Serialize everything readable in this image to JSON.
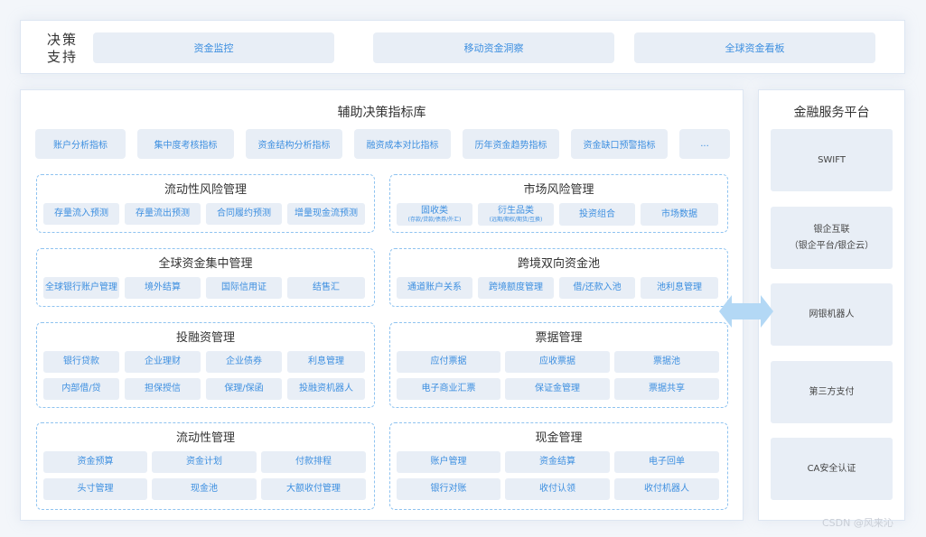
{
  "decision_support": {
    "label_line1": "决策",
    "label_line2": "支持",
    "buttons": [
      "资金监控",
      "移动资金洞察",
      "全球资金看板"
    ]
  },
  "indicator_library": {
    "title": "辅助决策指标库",
    "indicators": [
      "账户分析指标",
      "集中度考核指标",
      "资金结构分析指标",
      "融资成本对比指标",
      "历年资金趋势指标",
      "资金缺口预警指标",
      "..."
    ]
  },
  "groups": {
    "liquidity_risk": {
      "title": "流动性风险管理",
      "items": [
        "存量流入预测",
        "存量流出预测",
        "合同履约预测",
        "增量现金流预测"
      ]
    },
    "market_risk": {
      "title": "市场风险管理",
      "items": [
        {
          "label": "固收类",
          "sub": "(存款/贷款/债券/外汇)"
        },
        {
          "label": "衍生品类",
          "sub": "(远期/期权/期货/互换)"
        },
        {
          "label": "投资组合",
          "sub": ""
        },
        {
          "label": "市场数据",
          "sub": ""
        }
      ]
    },
    "global_concentration": {
      "title": "全球资金集中管理",
      "items": [
        "全球银行账户管理",
        "境外结算",
        "国际信用证",
        "结售汇"
      ]
    },
    "cross_border_pool": {
      "title": "跨境双向资金池",
      "items": [
        "通道账户关系",
        "跨境额度管理",
        "借/还款入池",
        "池利息管理"
      ]
    },
    "investment_financing": {
      "title": "投融资管理",
      "items": [
        "银行贷款",
        "企业理财",
        "企业债券",
        "利息管理",
        "内部借/贷",
        "担保授信",
        "保理/保函",
        "投融资机器人"
      ]
    },
    "bill_management": {
      "title": "票据管理",
      "items": [
        "应付票据",
        "应收票据",
        "票据池",
        "电子商业汇票",
        "保证金管理",
        "票据共享"
      ]
    },
    "liquidity_management": {
      "title": "流动性管理",
      "items": [
        "资金预算",
        "资金计划",
        "付款排程",
        "头寸管理",
        "现金池",
        "大额收付管理"
      ]
    },
    "cash_management": {
      "title": "现金管理",
      "items": [
        "账户管理",
        "资金结算",
        "电子回单",
        "银行对账",
        "收付认领",
        "收付机器人"
      ]
    }
  },
  "financial_platform": {
    "title": "金融服务平台",
    "services": [
      {
        "line1": "SWIFT",
        "line2": ""
      },
      {
        "line1": "银企互联",
        "line2": "（银企平台/银企云）"
      },
      {
        "line1": "网银机器人",
        "line2": ""
      },
      {
        "line1": "第三方支付",
        "line2": ""
      },
      {
        "line1": "CA安全认证",
        "line2": ""
      }
    ]
  },
  "connector": {
    "icon": "double-arrow-icon",
    "color": "#b3d8f5"
  },
  "watermark": "CSDN @风来沁",
  "colors": {
    "accent_text": "#3d8fe0",
    "cell_bg": "#e8eef6",
    "dashed_border": "#8fc3f0",
    "title_text": "#333333"
  }
}
